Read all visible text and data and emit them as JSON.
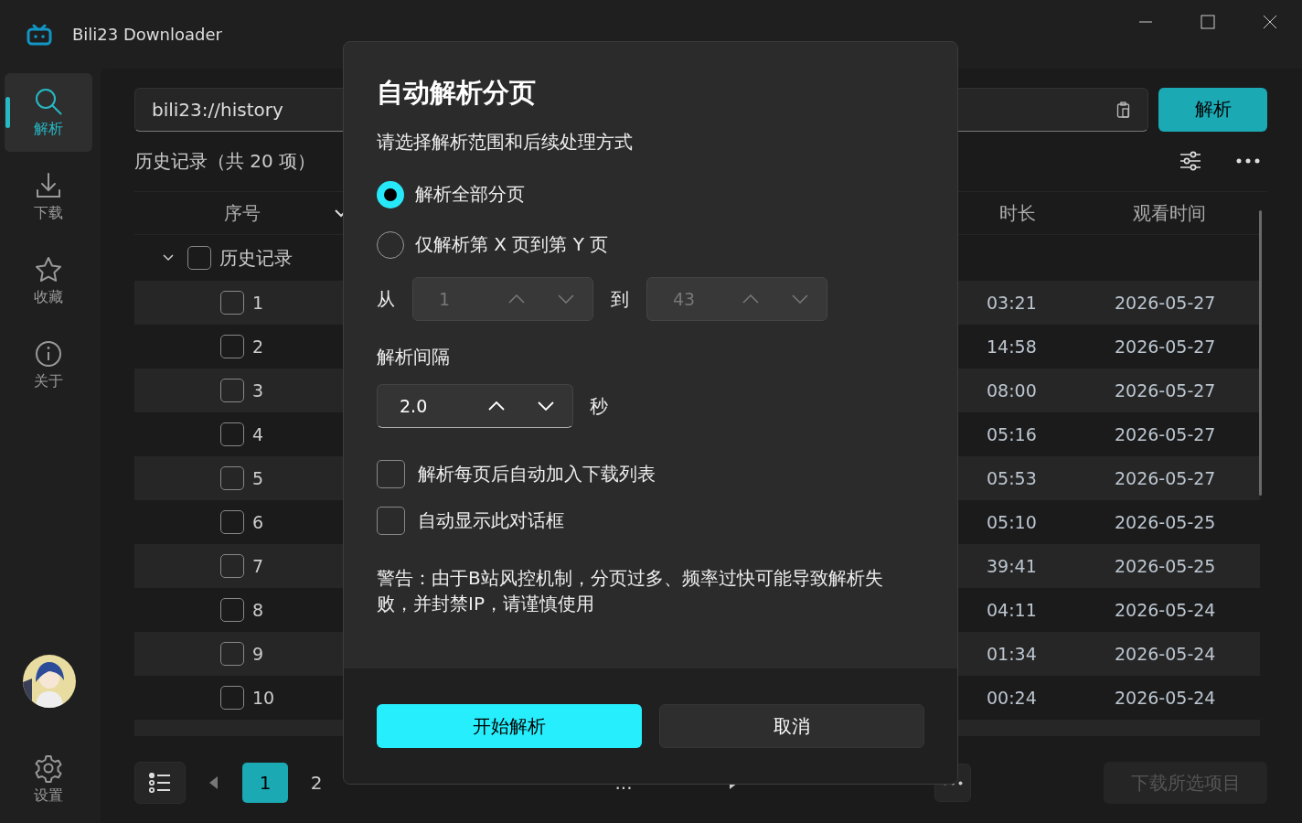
{
  "window": {
    "title": "Bili23 Downloader"
  },
  "sidebar": {
    "items": [
      {
        "label": "解析",
        "kind": "search",
        "selected": true
      },
      {
        "label": "下载",
        "kind": "download",
        "selected": false
      },
      {
        "label": "收藏",
        "kind": "star",
        "selected": false
      },
      {
        "label": "关于",
        "kind": "info",
        "selected": false
      }
    ],
    "settings": {
      "label": "设置"
    }
  },
  "url_field": {
    "value": "bili23://history"
  },
  "parse_button": {
    "label": "解析"
  },
  "list_title": "历史记录（共 20 项）",
  "table": {
    "columns": [
      "序号",
      "时长",
      "观看时间"
    ],
    "group": {
      "label": "历史记录",
      "expanded": true,
      "checked": false
    },
    "rows": [
      {
        "index": "1",
        "checked": false,
        "duration": "03:21",
        "watched": "2026-05-27"
      },
      {
        "index": "2",
        "checked": false,
        "duration": "14:58",
        "watched": "2026-05-27"
      },
      {
        "index": "3",
        "checked": false,
        "duration": "08:00",
        "watched": "2026-05-27"
      },
      {
        "index": "4",
        "checked": false,
        "duration": "05:16",
        "watched": "2026-05-27"
      },
      {
        "index": "5",
        "checked": false,
        "duration": "05:53",
        "watched": "2026-05-27"
      },
      {
        "index": "6",
        "checked": false,
        "duration": "05:10",
        "watched": "2026-05-25"
      },
      {
        "index": "7",
        "checked": false,
        "duration": "39:41",
        "watched": "2026-05-25"
      },
      {
        "index": "8",
        "checked": false,
        "duration": "04:11",
        "watched": "2026-05-24"
      },
      {
        "index": "9",
        "checked": false,
        "duration": "01:34",
        "watched": "2026-05-24"
      },
      {
        "index": "10",
        "checked": false,
        "duration": "00:24",
        "watched": "2026-05-24"
      }
    ]
  },
  "pagination": {
    "pages": [
      {
        "label": "1",
        "selected": true
      },
      {
        "label": "2",
        "selected": false
      }
    ],
    "ellipsis": "..."
  },
  "download_button": {
    "label": "下载所选项目",
    "disabled": true
  },
  "dialog": {
    "title": "自动解析分页",
    "subtitle": "请选择解析范围和后续处理方式",
    "options": [
      {
        "label": "解析全部分页",
        "selected": true
      },
      {
        "label": "仅解析第 X 页到第 Y 页",
        "selected": false
      }
    ],
    "range": {
      "from_label": "从",
      "from": "1",
      "to_label": "到",
      "to": "43",
      "disabled": true
    },
    "interval": {
      "label": "解析间隔",
      "value": "2.0",
      "unit": "秒"
    },
    "checks": [
      {
        "label": "解析每页后自动加入下载列表",
        "checked": false
      },
      {
        "label": "自动显示此对话框",
        "checked": false
      }
    ],
    "warning": "警告：由于B站风控机制，分页过多、频率过快可能导致解析失败，并封禁IP，请谨慎使用",
    "buttons": [
      {
        "label": "开始解析",
        "kind": "primary"
      },
      {
        "label": "取消",
        "kind": "secondary"
      }
    ]
  }
}
